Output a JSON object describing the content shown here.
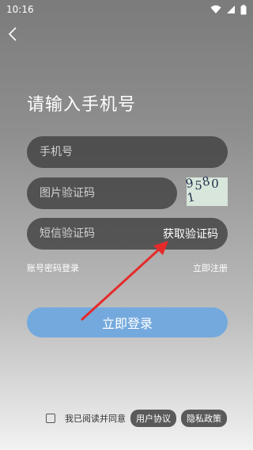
{
  "status_bar": {
    "time": "10:16"
  },
  "page": {
    "title": "请输入手机号"
  },
  "form": {
    "phone_placeholder": "手机号",
    "image_code_placeholder": "图片验证码",
    "captcha_text": "95801",
    "sms_code_placeholder": "短信验证码",
    "get_code_label": "获取验证码"
  },
  "links": {
    "password_login": "账号密码登录",
    "register": "立即注册"
  },
  "login_button": "立即登录",
  "agreement": {
    "text": "我已阅读并同意",
    "user_agreement": "用户协议",
    "privacy_policy": "隐私政策"
  },
  "colors": {
    "primary_button": "#74a9dd",
    "annotation_arrow": "#e52a2a"
  },
  "icons": [
    "back-icon",
    "wifi-icon",
    "signal-icon",
    "battery-icon",
    "checkbox-icon"
  ]
}
